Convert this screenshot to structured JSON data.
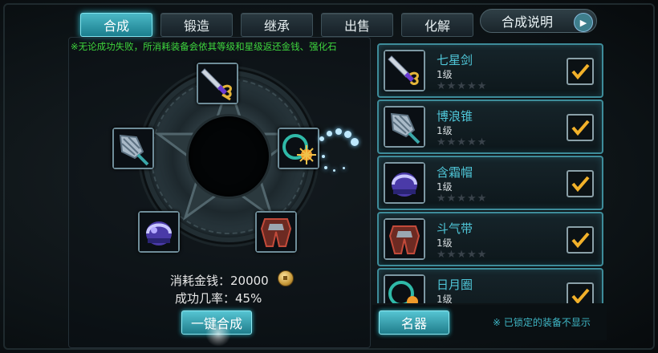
{
  "tabs": [
    {
      "label": "合成",
      "active": true
    },
    {
      "label": "锻造",
      "active": false
    },
    {
      "label": "继承",
      "active": false
    },
    {
      "label": "出售",
      "active": false
    },
    {
      "label": "化解",
      "active": false
    }
  ],
  "help_button": {
    "label": "合成说明",
    "icon": "play-arrow-icon"
  },
  "notice": "※无论成功失败，所消耗装备会依其等级和星级返还金钱、强化石",
  "synthesis": {
    "cost_label": "消耗金钱：20000",
    "rate_label": "成功几率：45%",
    "button_label": "一键合成",
    "coin_icon": "gold-coin-icon",
    "slots": [
      {
        "item": "七星剑",
        "icon": "sword-icon"
      },
      {
        "item": "日月圈",
        "icon": "ring-icon"
      },
      {
        "item": "斗气带",
        "icon": "belt-icon"
      },
      {
        "item": "含霜帽",
        "icon": "helmet-icon"
      },
      {
        "item": "博浪锥",
        "icon": "mace-icon"
      }
    ]
  },
  "equipment_list": [
    {
      "name": "七星剑",
      "level": "1级",
      "stars": "★★★★★",
      "star_count": 0,
      "checked": true,
      "icon": "sword-icon"
    },
    {
      "name": "博浪锥",
      "level": "1级",
      "stars": "★★★★★",
      "star_count": 0,
      "checked": true,
      "icon": "mace-icon"
    },
    {
      "name": "含霜帽",
      "level": "1级",
      "stars": "★★★★★",
      "star_count": 0,
      "checked": true,
      "icon": "helmet-icon"
    },
    {
      "name": "斗气带",
      "level": "1级",
      "stars": "★★★★★",
      "star_count": 0,
      "checked": true,
      "icon": "belt-icon"
    },
    {
      "name": "日月圈",
      "level": "1级",
      "stars": "★★★★★",
      "star_count": 0,
      "checked": true,
      "icon": "ring-icon"
    }
  ],
  "filter_button": {
    "label": "名器"
  },
  "hint": "※ 已锁定的装备不显示",
  "colors": {
    "accent": "#36c6d8",
    "notice_green": "#3ed63e",
    "item_name": "#4fc6d8",
    "checkmark": "#f2b12a"
  }
}
